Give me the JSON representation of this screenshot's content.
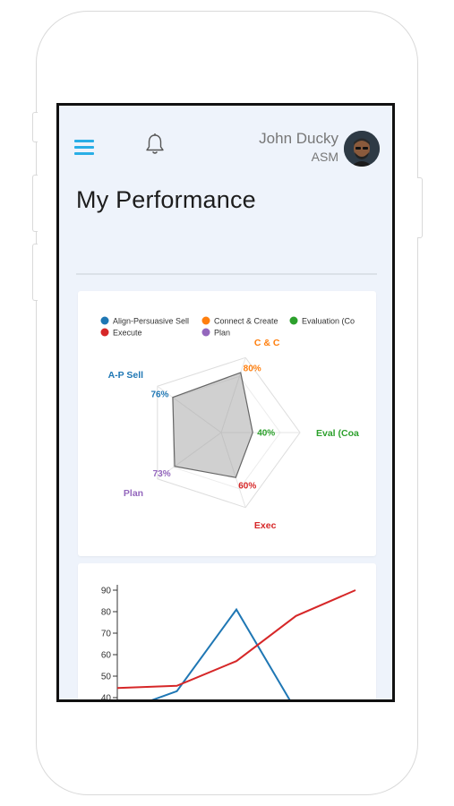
{
  "header": {
    "user_name": "John Ducky",
    "user_role": "ASM",
    "menu_icon": "hamburger-menu-icon",
    "notification_icon": "bell-icon",
    "accent_color": "#29aee6"
  },
  "page": {
    "title": "My Performance"
  },
  "chart_data": [
    {
      "type": "radar",
      "legend_position": "top",
      "legend": [
        {
          "name": "Align-Persuasive Sell",
          "color": "#1f77b4"
        },
        {
          "name": "Connect & Create",
          "color": "#ff7f0e"
        },
        {
          "name": "Evaluation (Co",
          "color": "#2ca02c"
        },
        {
          "name": "Execute",
          "color": "#d62728"
        },
        {
          "name": "Plan",
          "color": "#9467bd"
        }
      ],
      "axes": [
        {
          "label": "C & C",
          "value": 80,
          "value_label": "80%",
          "color": "#ff7f0e"
        },
        {
          "label": "Eval (Coa",
          "value": 40,
          "value_label": "40%",
          "color": "#2ca02c"
        },
        {
          "label": "Exec",
          "value": 60,
          "value_label": "60%",
          "color": "#d62728"
        },
        {
          "label": "Plan",
          "value": 73,
          "value_label": "73%",
          "color": "#9467bd"
        },
        {
          "label": "A-P Sell",
          "value": 76,
          "value_label": "76%",
          "color": "#1f77b4"
        }
      ],
      "max": 100
    },
    {
      "type": "line",
      "ylim": [
        40,
        90
      ],
      "yticks": [
        40,
        50,
        60,
        70,
        80,
        90
      ],
      "x": [
        0,
        1,
        2,
        3,
        4
      ],
      "series": [
        {
          "color": "#1f77b4",
          "values": [
            33,
            43,
            81,
            34,
            20
          ]
        },
        {
          "color": "#d62728",
          "values": [
            44.5,
            45.5,
            57,
            78,
            90
          ]
        }
      ]
    }
  ]
}
